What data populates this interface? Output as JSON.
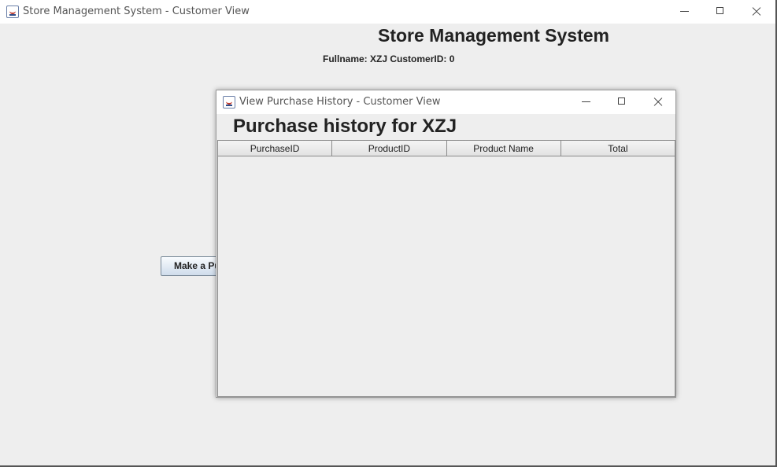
{
  "main_window": {
    "title": "Store Management System - Customer View",
    "heading": "Store Management System",
    "user_info": "Fullname: XZJ  CustomerID: 0",
    "make_purchase_label": "Make a Purchase"
  },
  "dialog": {
    "title": "View Purchase History - Customer View",
    "heading": "Purchase history for XZJ",
    "table": {
      "columns": [
        "PurchaseID",
        "ProductID",
        "Product Name",
        "Total"
      ],
      "rows": []
    }
  },
  "icons": {
    "app": "java-icon",
    "minimize": "minimize-icon",
    "maximize": "maximize-icon",
    "close": "close-icon"
  }
}
